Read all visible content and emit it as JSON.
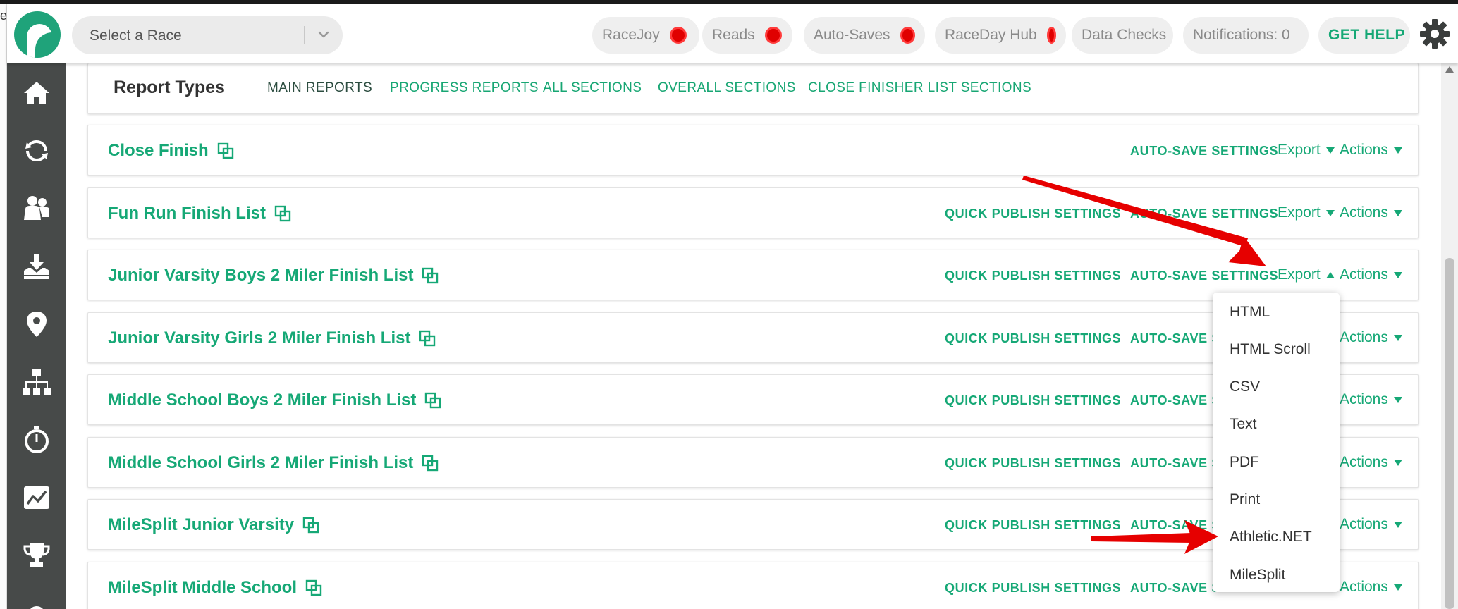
{
  "edge_fragment": "e",
  "header": {
    "race_select_placeholder": "Select a Race",
    "pills": [
      {
        "label": "RaceJoy",
        "status": "red"
      },
      {
        "label": "Reads",
        "status": "red"
      },
      {
        "label": "Auto-Saves",
        "status": "red"
      },
      {
        "label": "RaceDay Hub",
        "status": "red"
      },
      {
        "label": "Data Checks"
      },
      {
        "label": "Notifications: 0"
      }
    ],
    "help_label": "GET HELP"
  },
  "sidebar": {
    "items": [
      "home-icon",
      "sync-icon",
      "participants-icon",
      "import-icon",
      "location-icon",
      "hierarchy-icon",
      "stopwatch-icon",
      "chart-icon",
      "trophy-icon",
      "settings-icon"
    ]
  },
  "report_types": {
    "title": "Report Types",
    "tabs": [
      "MAIN REPORTS",
      "PROGRESS REPORTS",
      "ALL SECTIONS",
      "OVERALL SECTIONS",
      "CLOSE FINISHER LIST SECTIONS"
    ],
    "active_tab": "MAIN REPORTS"
  },
  "labels": {
    "quick_publish": "QUICK PUBLISH SETTINGS",
    "auto_save": "AUTO-SAVE SETTINGS",
    "export": "Export",
    "actions": "Actions"
  },
  "reports": [
    {
      "name": "Close Finish",
      "quick_publish": false
    },
    {
      "name": "Fun Run Finish List",
      "quick_publish": true
    },
    {
      "name": "Junior Varsity Boys 2 Miler Finish List",
      "quick_publish": true,
      "export_open": true
    },
    {
      "name": "Junior Varsity Girls 2 Miler Finish List",
      "quick_publish": true
    },
    {
      "name": "Middle School Boys 2 Miler Finish List",
      "quick_publish": true
    },
    {
      "name": "Middle School Girls 2 Miler Finish List",
      "quick_publish": true
    },
    {
      "name": "MileSplit Junior Varsity",
      "quick_publish": true
    },
    {
      "name": "MileSplit Middle School",
      "quick_publish": true
    }
  ],
  "export_menu": {
    "items": [
      "HTML",
      "HTML Scroll",
      "CSV",
      "Text",
      "PDF",
      "Print",
      "Athletic.NET",
      "MileSplit"
    ]
  },
  "colors": {
    "accent": "#16a876",
    "sidebar": "#474a49",
    "status_red": "#e00000",
    "annotation_arrow": "#e60000"
  }
}
